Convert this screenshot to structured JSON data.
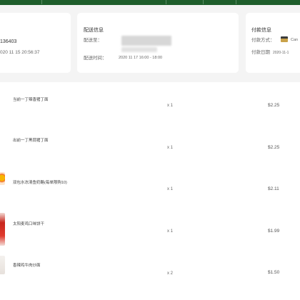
{
  "order": {
    "number": "136403",
    "date": "020 11 15 20:56:37"
  },
  "delivery": {
    "title": "配送信息",
    "address_label": "配送至：",
    "time_label": "配送时间：",
    "time_value": "2020 11 17 16:00 - 18:00"
  },
  "payment": {
    "title": "付款信息",
    "method_label": "付款方式：",
    "method_value": "Can",
    "date_label": "付款日期",
    "date_value": "2020-11-1"
  },
  "items": [
    {
      "name": "当前一丁辣香猪丁面",
      "qty": "x 1",
      "price": "$2.25"
    },
    {
      "name": "出前一丁黑蒜猪丁面",
      "qty": "x 1",
      "price": "$2.25"
    },
    {
      "name": "双包水冻清鱼奶酪(每单限购10)",
      "qty": "x 1",
      "price": "$2.11"
    },
    {
      "name": "太阳麦鸡口味饼干",
      "qty": "x 1",
      "price": "$1.99"
    },
    {
      "name": "香辣鸡牛肉炒面",
      "qty": "x 2",
      "price": "$1.50"
    }
  ],
  "colors": {
    "nav_bg": "#1e5e2b",
    "card_bg": "#ffffff",
    "page_bg": "#f4f4f4"
  }
}
